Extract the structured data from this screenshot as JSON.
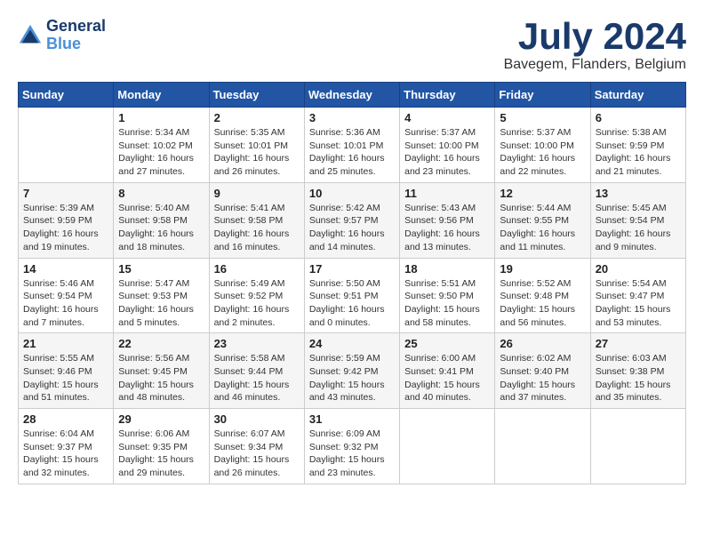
{
  "header": {
    "logo_line1": "General",
    "logo_line2": "Blue",
    "month": "July 2024",
    "location": "Bavegem, Flanders, Belgium"
  },
  "columns": [
    "Sunday",
    "Monday",
    "Tuesday",
    "Wednesday",
    "Thursday",
    "Friday",
    "Saturday"
  ],
  "weeks": [
    [
      {
        "day": "",
        "info": ""
      },
      {
        "day": "1",
        "info": "Sunrise: 5:34 AM\nSunset: 10:02 PM\nDaylight: 16 hours\nand 27 minutes."
      },
      {
        "day": "2",
        "info": "Sunrise: 5:35 AM\nSunset: 10:01 PM\nDaylight: 16 hours\nand 26 minutes."
      },
      {
        "day": "3",
        "info": "Sunrise: 5:36 AM\nSunset: 10:01 PM\nDaylight: 16 hours\nand 25 minutes."
      },
      {
        "day": "4",
        "info": "Sunrise: 5:37 AM\nSunset: 10:00 PM\nDaylight: 16 hours\nand 23 minutes."
      },
      {
        "day": "5",
        "info": "Sunrise: 5:37 AM\nSunset: 10:00 PM\nDaylight: 16 hours\nand 22 minutes."
      },
      {
        "day": "6",
        "info": "Sunrise: 5:38 AM\nSunset: 9:59 PM\nDaylight: 16 hours\nand 21 minutes."
      }
    ],
    [
      {
        "day": "7",
        "info": "Sunrise: 5:39 AM\nSunset: 9:59 PM\nDaylight: 16 hours\nand 19 minutes."
      },
      {
        "day": "8",
        "info": "Sunrise: 5:40 AM\nSunset: 9:58 PM\nDaylight: 16 hours\nand 18 minutes."
      },
      {
        "day": "9",
        "info": "Sunrise: 5:41 AM\nSunset: 9:58 PM\nDaylight: 16 hours\nand 16 minutes."
      },
      {
        "day": "10",
        "info": "Sunrise: 5:42 AM\nSunset: 9:57 PM\nDaylight: 16 hours\nand 14 minutes."
      },
      {
        "day": "11",
        "info": "Sunrise: 5:43 AM\nSunset: 9:56 PM\nDaylight: 16 hours\nand 13 minutes."
      },
      {
        "day": "12",
        "info": "Sunrise: 5:44 AM\nSunset: 9:55 PM\nDaylight: 16 hours\nand 11 minutes."
      },
      {
        "day": "13",
        "info": "Sunrise: 5:45 AM\nSunset: 9:54 PM\nDaylight: 16 hours\nand 9 minutes."
      }
    ],
    [
      {
        "day": "14",
        "info": "Sunrise: 5:46 AM\nSunset: 9:54 PM\nDaylight: 16 hours\nand 7 minutes."
      },
      {
        "day": "15",
        "info": "Sunrise: 5:47 AM\nSunset: 9:53 PM\nDaylight: 16 hours\nand 5 minutes."
      },
      {
        "day": "16",
        "info": "Sunrise: 5:49 AM\nSunset: 9:52 PM\nDaylight: 16 hours\nand 2 minutes."
      },
      {
        "day": "17",
        "info": "Sunrise: 5:50 AM\nSunset: 9:51 PM\nDaylight: 16 hours\nand 0 minutes."
      },
      {
        "day": "18",
        "info": "Sunrise: 5:51 AM\nSunset: 9:50 PM\nDaylight: 15 hours\nand 58 minutes."
      },
      {
        "day": "19",
        "info": "Sunrise: 5:52 AM\nSunset: 9:48 PM\nDaylight: 15 hours\nand 56 minutes."
      },
      {
        "day": "20",
        "info": "Sunrise: 5:54 AM\nSunset: 9:47 PM\nDaylight: 15 hours\nand 53 minutes."
      }
    ],
    [
      {
        "day": "21",
        "info": "Sunrise: 5:55 AM\nSunset: 9:46 PM\nDaylight: 15 hours\nand 51 minutes."
      },
      {
        "day": "22",
        "info": "Sunrise: 5:56 AM\nSunset: 9:45 PM\nDaylight: 15 hours\nand 48 minutes."
      },
      {
        "day": "23",
        "info": "Sunrise: 5:58 AM\nSunset: 9:44 PM\nDaylight: 15 hours\nand 46 minutes."
      },
      {
        "day": "24",
        "info": "Sunrise: 5:59 AM\nSunset: 9:42 PM\nDaylight: 15 hours\nand 43 minutes."
      },
      {
        "day": "25",
        "info": "Sunrise: 6:00 AM\nSunset: 9:41 PM\nDaylight: 15 hours\nand 40 minutes."
      },
      {
        "day": "26",
        "info": "Sunrise: 6:02 AM\nSunset: 9:40 PM\nDaylight: 15 hours\nand 37 minutes."
      },
      {
        "day": "27",
        "info": "Sunrise: 6:03 AM\nSunset: 9:38 PM\nDaylight: 15 hours\nand 35 minutes."
      }
    ],
    [
      {
        "day": "28",
        "info": "Sunrise: 6:04 AM\nSunset: 9:37 PM\nDaylight: 15 hours\nand 32 minutes."
      },
      {
        "day": "29",
        "info": "Sunrise: 6:06 AM\nSunset: 9:35 PM\nDaylight: 15 hours\nand 29 minutes."
      },
      {
        "day": "30",
        "info": "Sunrise: 6:07 AM\nSunset: 9:34 PM\nDaylight: 15 hours\nand 26 minutes."
      },
      {
        "day": "31",
        "info": "Sunrise: 6:09 AM\nSunset: 9:32 PM\nDaylight: 15 hours\nand 23 minutes."
      },
      {
        "day": "",
        "info": ""
      },
      {
        "day": "",
        "info": ""
      },
      {
        "day": "",
        "info": ""
      }
    ]
  ]
}
